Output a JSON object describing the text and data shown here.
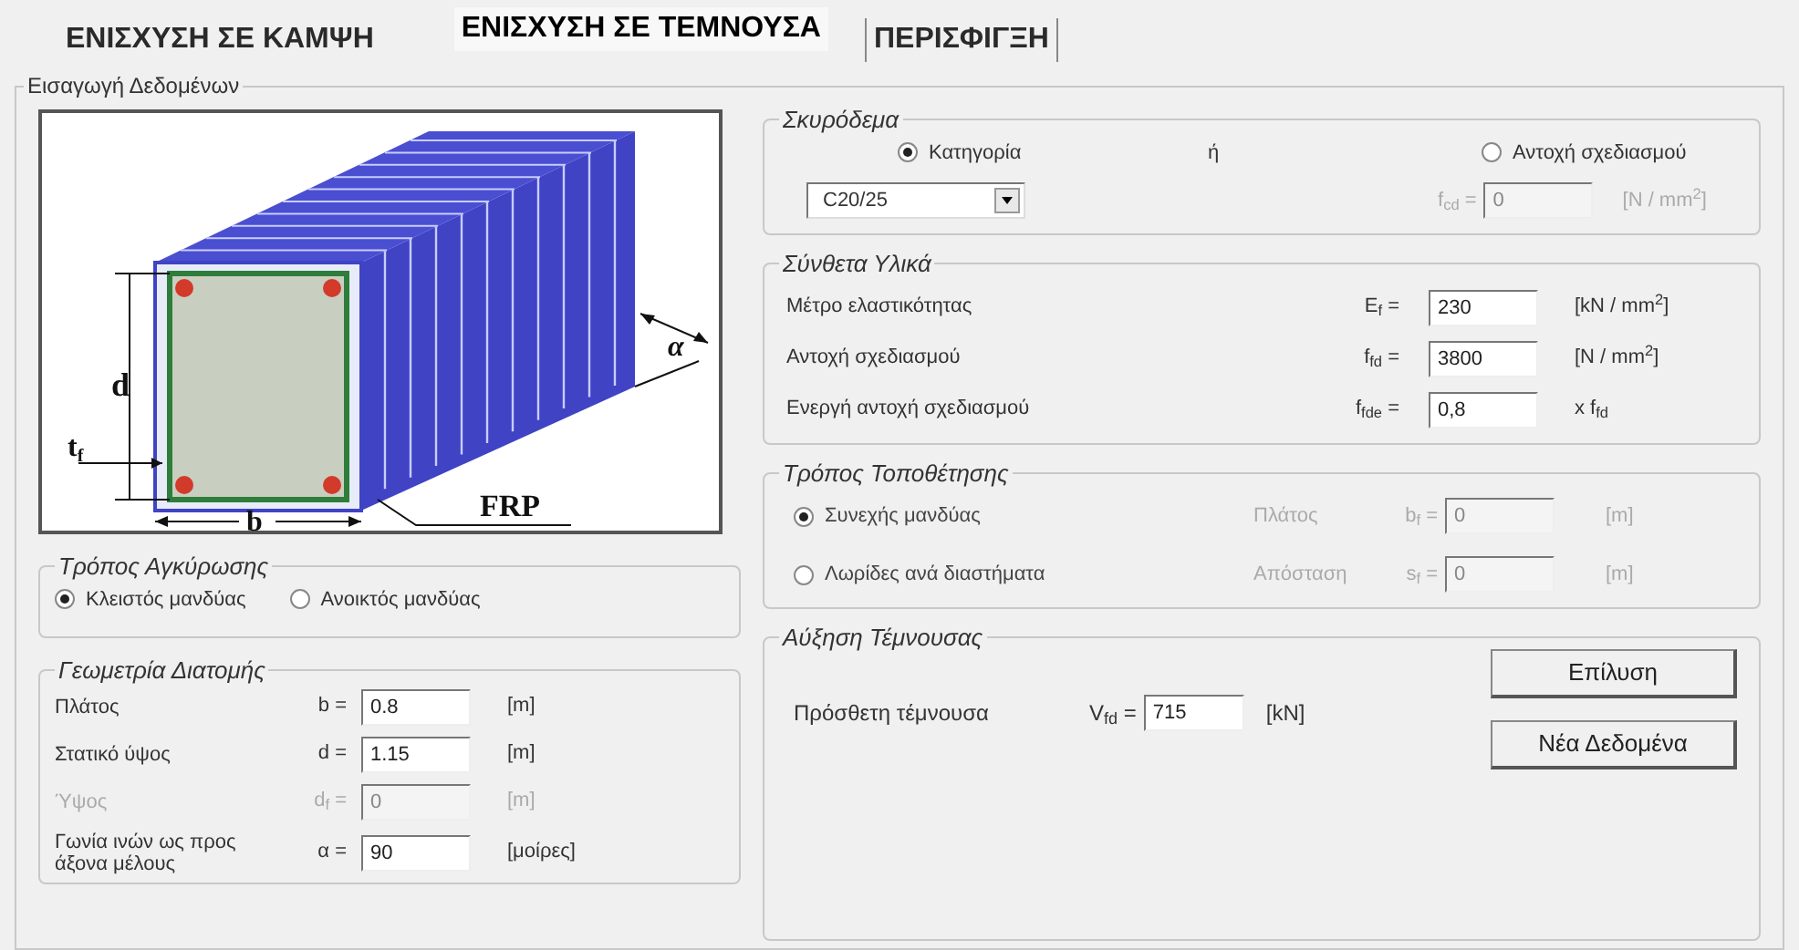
{
  "tabs": [
    {
      "label": "ΕΝΙΣΧΥΣΗ ΣΕ ΚΑΜΨΗ",
      "selected": false,
      "focused": false
    },
    {
      "label": "ΕΝΙΣΧΥΣΗ ΣΕ ΤΕΜΝΟΥΣΑ",
      "selected": true,
      "focused": false
    },
    {
      "label": "ΠΕΡΙΣΦΙΓΞΗ",
      "selected": false,
      "focused": true
    }
  ],
  "input_frame": {
    "title": "Εισαγωγή Δεδομένων"
  },
  "diagram": {
    "labels": [
      "d",
      "t$_{f}$",
      "b",
      "FRP",
      "α"
    ]
  },
  "anchorage": {
    "title": "Τρόπος Αγκύρωσης",
    "options": [
      {
        "label": "Κλειστός μανδύας",
        "selected": true
      },
      {
        "label": "Ανοικτός μανδύας",
        "selected": false
      }
    ]
  },
  "geometry": {
    "title": "Γεωμετρία Διατομής",
    "rows": [
      {
        "label": "Πλάτος",
        "symbol": "b =",
        "value": "0.8",
        "unit": "[m]",
        "disabled": false
      },
      {
        "label": "Στατικό ύψος",
        "symbol": "d =",
        "value": "1.15",
        "unit": "[m]",
        "disabled": false
      },
      {
        "label": "Ύψος",
        "symbol": "d$_{f}$ =",
        "value": "0",
        "unit": "[m]",
        "disabled": true
      },
      {
        "label": "Γωνία ινών ως προς άξονα μέλους",
        "symbol": "α =",
        "value": "90",
        "unit": "[μοίρες]",
        "disabled": false
      }
    ]
  },
  "concrete": {
    "title": "Σκυρόδεμα",
    "options": [
      {
        "label": "Κατηγορία",
        "selected": true
      },
      {
        "label": "Αντοχή σχεδιασμού",
        "selected": false
      }
    ],
    "or_label": "ή",
    "category": "C20/25",
    "fcd": {
      "symbol": "f$_{cd}$ =",
      "value": "0",
      "unit": "[N / mm$^{2}$]",
      "disabled": true
    }
  },
  "composite": {
    "title": "Σύνθετα Υλικά",
    "rows": [
      {
        "label": "Μέτρο ελαστικότητας",
        "symbol": "E$_{f}$ =",
        "value": "230",
        "unit": "[kN / mm$^{2}$]"
      },
      {
        "label": "Αντοχή σχεδιασμού",
        "symbol": "f$_{fd}$ =",
        "value": "3800",
        "unit": "[N / mm$^{2}$]"
      },
      {
        "label": "Ενεργή αντοχή σχεδιασμού",
        "symbol": "f$_{fde}$ =",
        "value": "0,8",
        "unit": "x f$_{fd}$"
      }
    ]
  },
  "placement": {
    "title": "Τρόπος Τοποθέτησης",
    "rows": [
      {
        "label": "Συνεχής μανδύας",
        "selected": true,
        "field_label": "Πλάτος",
        "symbol": "b$_{f}$ =",
        "value": "0",
        "unit": "[m]",
        "disabled": true
      },
      {
        "label": "Λωρίδες ανά διαστήματα",
        "selected": false,
        "field_label": "Απόσταση",
        "symbol": "s$_{f}$ =",
        "value": "0",
        "unit": "[m]",
        "disabled": true
      }
    ]
  },
  "shear_increase": {
    "title": "Αύξηση Τέμνουσας",
    "label": "Πρόσθετη τέμνουσα",
    "symbol": "V$_{fd}$ =",
    "value": "715",
    "unit": "[kN]",
    "buttons": [
      "Επίλυση",
      "Νέα Δεδομένα"
    ]
  }
}
